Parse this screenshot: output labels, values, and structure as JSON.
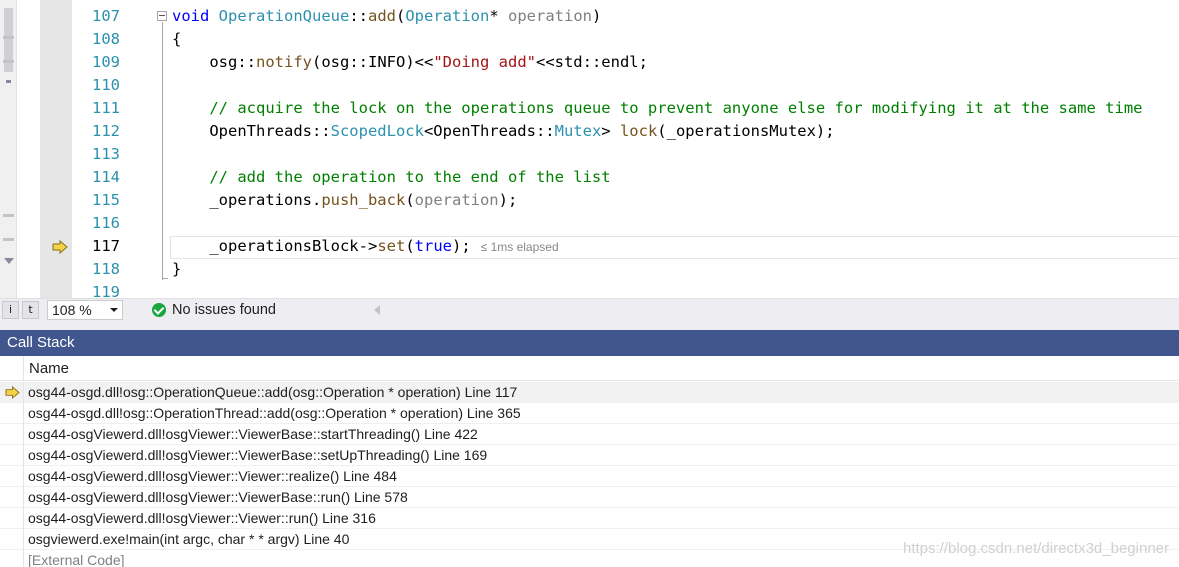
{
  "editor": {
    "line_numbers": [
      "107",
      "108",
      "109",
      "110",
      "111",
      "112",
      "113",
      "114",
      "115",
      "116",
      "117",
      "118",
      "119"
    ],
    "current_line": "117",
    "lines": [
      [
        {
          "t": "void",
          "c": "kw"
        },
        {
          "t": " "
        },
        {
          "t": "OperationQueue",
          "c": "cls"
        },
        {
          "t": "::"
        },
        {
          "t": "add",
          "c": "fn"
        },
        {
          "t": "("
        },
        {
          "t": "Operation",
          "c": "cls"
        },
        {
          "t": "* "
        },
        {
          "t": "operation",
          "c": "prm"
        },
        {
          "t": ")"
        }
      ],
      [
        {
          "t": "{"
        }
      ],
      [
        {
          "t": "    osg::"
        },
        {
          "t": "notify",
          "c": "fn"
        },
        {
          "t": "(osg::INFO)<<"
        },
        {
          "t": "\"Doing add\"",
          "c": "str"
        },
        {
          "t": "<<std::endl;"
        }
      ],
      [],
      [
        {
          "t": "    // acquire the lock on the operations queue to prevent anyone else for modifying it at the same time",
          "c": "cm"
        }
      ],
      [
        {
          "t": "    OpenThreads::"
        },
        {
          "t": "ScopedLock",
          "c": "cls"
        },
        {
          "t": "<OpenThreads::"
        },
        {
          "t": "Mutex",
          "c": "cls"
        },
        {
          "t": "> "
        },
        {
          "t": "lock",
          "c": "fn"
        },
        {
          "t": "(_operationsMutex);"
        }
      ],
      [],
      [
        {
          "t": "    // add the operation to the end of the list",
          "c": "cm"
        }
      ],
      [
        {
          "t": "    _operations."
        },
        {
          "t": "push_back",
          "c": "fn"
        },
        {
          "t": "("
        },
        {
          "t": "operation",
          "c": "prm"
        },
        {
          "t": ");"
        }
      ],
      [],
      [
        {
          "t": "    _operationsBlock->"
        },
        {
          "t": "set",
          "c": "fn"
        },
        {
          "t": "("
        },
        {
          "t": "true",
          "c": "kw"
        },
        {
          "t": ");"
        }
      ],
      [
        {
          "t": "}"
        }
      ],
      []
    ],
    "perf_tip": "≤ 1ms elapsed"
  },
  "statusbar": {
    "zoom": "108 %",
    "issues": "No issues found",
    "left_icon_1": "i",
    "left_icon_2": "t"
  },
  "callstack": {
    "title": "Call Stack",
    "column_header": "Name",
    "rows": [
      {
        "text": "osg44-osgd.dll!osg::OperationQueue::add(osg::Operation * operation) Line 117",
        "active": true
      },
      {
        "text": "osg44-osgd.dll!osg::OperationThread::add(osg::Operation * operation) Line 365"
      },
      {
        "text": "osg44-osgViewerd.dll!osgViewer::ViewerBase::startThreading() Line 422"
      },
      {
        "text": "osg44-osgViewerd.dll!osgViewer::ViewerBase::setUpThreading() Line 169"
      },
      {
        "text": "osg44-osgViewerd.dll!osgViewer::Viewer::realize() Line 484"
      },
      {
        "text": "osg44-osgViewerd.dll!osgViewer::ViewerBase::run() Line 578"
      },
      {
        "text": "osg44-osgViewerd.dll!osgViewer::Viewer::run() Line 316"
      },
      {
        "text": "osgviewerd.exe!main(int argc, char * * argv) Line 40"
      },
      {
        "text": "[External Code]",
        "external": true
      }
    ]
  },
  "watermark": "https://blog.csdn.net/directx3d_beginner",
  "colors": {
    "keyword": "#0000ff",
    "type": "#2b91af",
    "function": "#74531f",
    "string": "#a31515",
    "comment": "#008000",
    "parameter": "#808080",
    "panel_title_bg": "#40568d",
    "exec_arrow": "#f5d24a"
  },
  "icons": [
    "execution-arrow-icon",
    "check-circle-icon",
    "dropdown-chevron-icon",
    "scroll-left-arrow-icon"
  ]
}
